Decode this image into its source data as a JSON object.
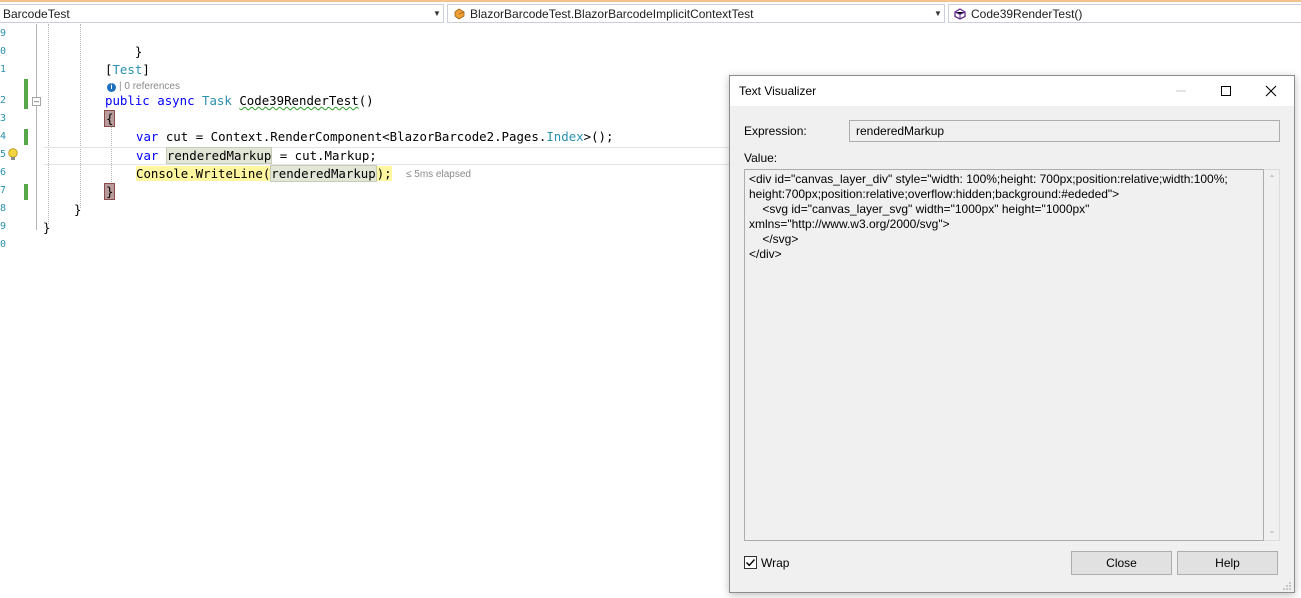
{
  "navbar": {
    "project": "BarcodeTest",
    "class_name": "BlazorBarcodeTest.BlazorBarcodeImplicitContextTest",
    "member": "Code39RenderTest()"
  },
  "editor": {
    "line_numbers": [
      "9",
      "0",
      "1",
      "2",
      "3",
      "4",
      "5",
      "6",
      "7",
      "8",
      "9",
      "0"
    ],
    "lines": {
      "l1_brace": "}",
      "l3_attr_open": "[",
      "l3_attr_name": "Test",
      "l3_attr_close": "]",
      "codelens_refs": "| 0 references",
      "l4_public": "public",
      "l4_async": "async",
      "l4_task": "Task",
      "l4_method": "Code39RenderTest",
      "l4_parens": "()",
      "l5_open": "{",
      "l6_var": "var",
      "l6_rest1": " cut = Context.RenderComponent<BlazorBarcode2.Pages.",
      "l6_index": "Index",
      "l6_rest2": ">();",
      "l7_var": "var",
      "l7_name": "renderedMarkup",
      "l7_rest": " = cut.Markup;",
      "l8_call1": "Console.WriteLine(",
      "l8_arg": "renderedMarkup",
      "l8_call2": ");",
      "l8_elapsed": "≤ 5ms elapsed",
      "l9_close": "}",
      "l10_close": "}",
      "l11_close": "}"
    }
  },
  "dialog": {
    "title": "Text Visualizer",
    "expression_label": "Expression:",
    "expression_value": "renderedMarkup",
    "value_label": "Value:",
    "value_lines": [
      "<div id=\"canvas_layer_div\" style=\"width: 100%;height: 700px;position:relative;width:100%;",
      "height:700px;position:relative;overflow:hidden;background:#ededed\">",
      "    <svg id=\"canvas_layer_svg\" width=\"1000px\" height=\"1000px\"",
      "xmlns=\"http://www.w3.org/2000/svg\">",
      "    </svg>",
      "</div>"
    ],
    "wrap_label": "Wrap",
    "wrap_checked": true,
    "close_label": "Close",
    "help_label": "Help"
  },
  "colors": {
    "keyword": "#0000ff",
    "type": "#2b91af",
    "change_bar": "#57a64a",
    "brace_highlight": "#b89b9b",
    "statement_highlight": "#fff6a0"
  }
}
